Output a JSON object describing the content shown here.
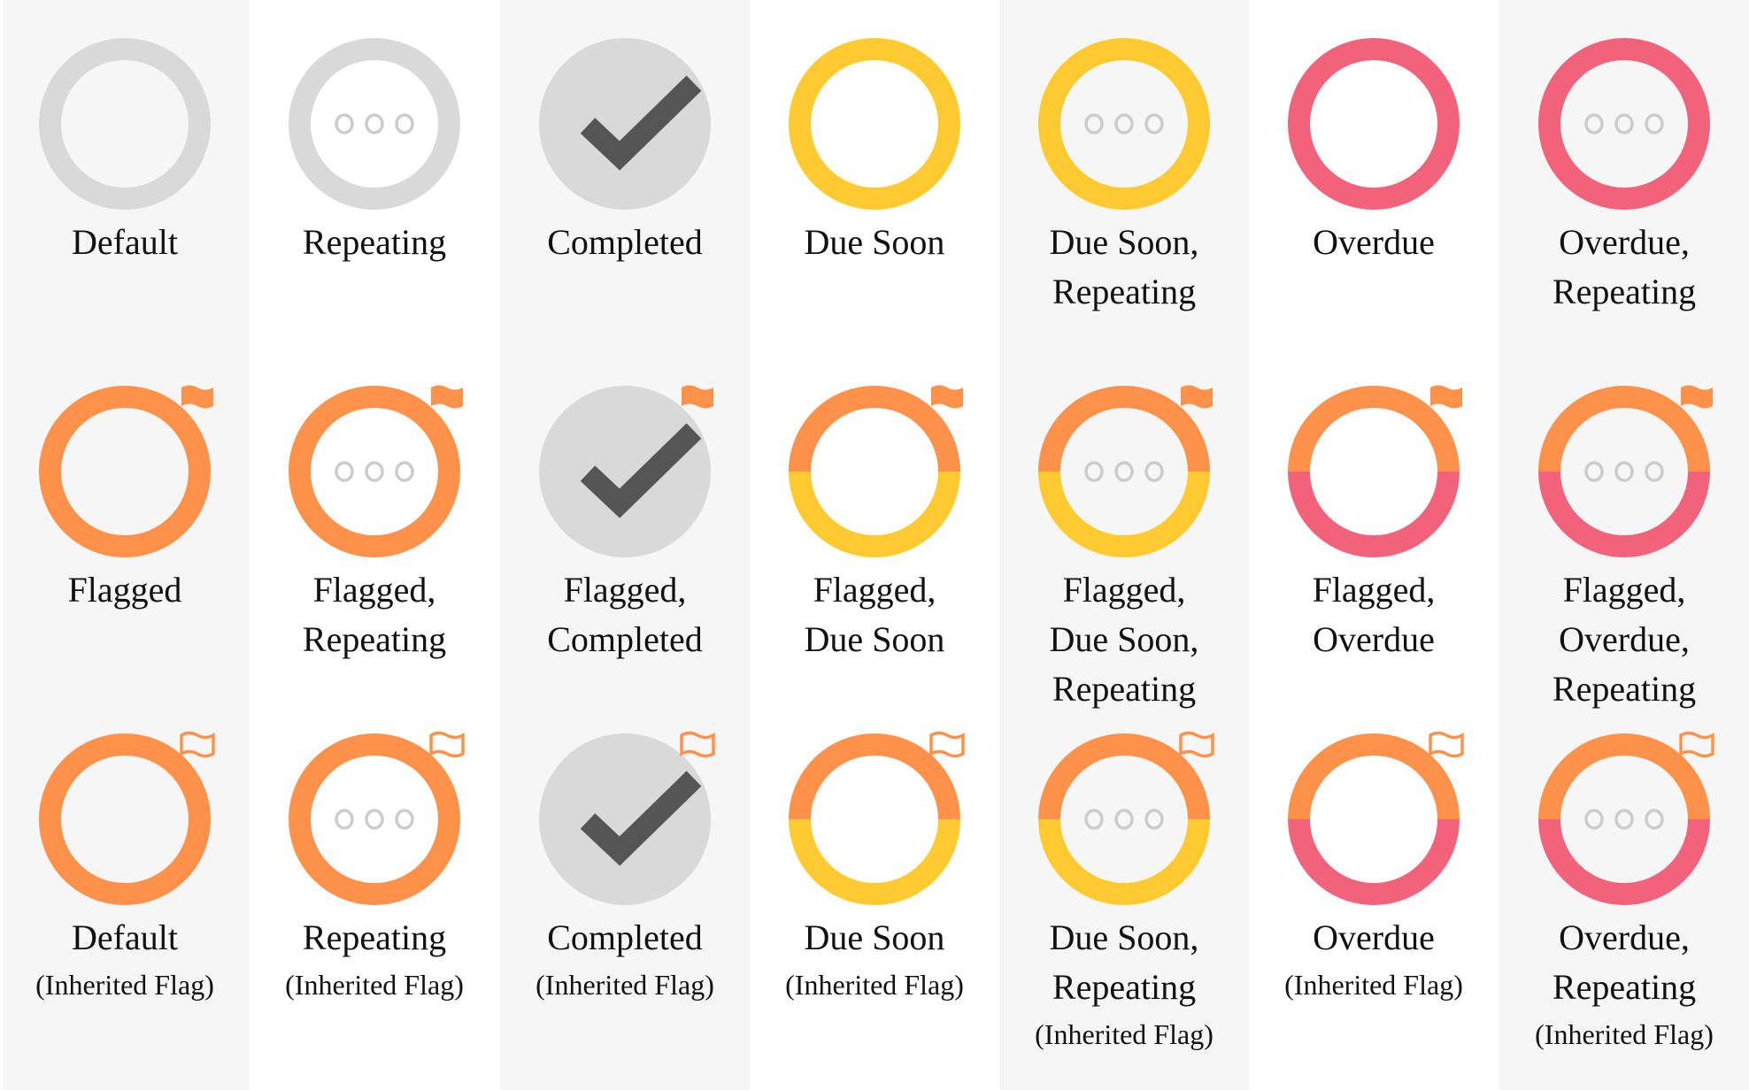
{
  "colors": {
    "gray": "#d9d9d9",
    "yellow": "#ffca30",
    "red": "#f2637b",
    "orange": "#ff914a",
    "check": "#555555",
    "dots": "#cccccc",
    "shade": "#f6f6f6"
  },
  "rows": [
    [
      {
        "lines": [
          "Default"
        ],
        "ring": "gray",
        "repeating": false,
        "completed": false,
        "flag": "none"
      },
      {
        "lines": [
          "Repeating"
        ],
        "ring": "gray",
        "repeating": true,
        "completed": false,
        "flag": "none"
      },
      {
        "lines": [
          "Completed"
        ],
        "ring": "gray",
        "repeating": false,
        "completed": true,
        "flag": "none"
      },
      {
        "lines": [
          "Due Soon"
        ],
        "ring": "yellow",
        "repeating": false,
        "completed": false,
        "flag": "none"
      },
      {
        "lines": [
          "Due Soon,",
          "Repeating"
        ],
        "ring": "yellow",
        "repeating": true,
        "completed": false,
        "flag": "none"
      },
      {
        "lines": [
          "Overdue"
        ],
        "ring": "red",
        "repeating": false,
        "completed": false,
        "flag": "none"
      },
      {
        "lines": [
          "Overdue,",
          "Repeating"
        ],
        "ring": "red",
        "repeating": true,
        "completed": false,
        "flag": "none"
      }
    ],
    [
      {
        "lines": [
          "Flagged"
        ],
        "ring": "orange",
        "repeating": false,
        "completed": false,
        "flag": "solid"
      },
      {
        "lines": [
          "Flagged,",
          "Repeating"
        ],
        "ring": "orange",
        "repeating": true,
        "completed": false,
        "flag": "solid"
      },
      {
        "lines": [
          "Flagged,",
          "Completed"
        ],
        "ring": "gray",
        "repeating": false,
        "completed": true,
        "flag": "solid"
      },
      {
        "lines": [
          "Flagged,",
          "Due Soon"
        ],
        "ring": "orange-yellow",
        "repeating": false,
        "completed": false,
        "flag": "solid"
      },
      {
        "lines": [
          "Flagged,",
          "Due Soon,",
          "Repeating"
        ],
        "ring": "orange-yellow",
        "repeating": true,
        "completed": false,
        "flag": "solid"
      },
      {
        "lines": [
          "Flagged,",
          "Overdue"
        ],
        "ring": "orange-red",
        "repeating": false,
        "completed": false,
        "flag": "solid"
      },
      {
        "lines": [
          "Flagged,",
          "Overdue,",
          "Repeating"
        ],
        "ring": "orange-red",
        "repeating": true,
        "completed": false,
        "flag": "solid"
      }
    ],
    [
      {
        "lines": [
          "Default"
        ],
        "sub": "(Inherited Flag)",
        "ring": "orange",
        "repeating": false,
        "completed": false,
        "flag": "outline"
      },
      {
        "lines": [
          "Repeating"
        ],
        "sub": "(Inherited Flag)",
        "ring": "orange",
        "repeating": true,
        "completed": false,
        "flag": "outline"
      },
      {
        "lines": [
          "Completed"
        ],
        "sub": "(Inherited Flag)",
        "ring": "gray",
        "repeating": false,
        "completed": true,
        "flag": "outline"
      },
      {
        "lines": [
          "Due Soon"
        ],
        "sub": "(Inherited Flag)",
        "ring": "orange-yellow",
        "repeating": false,
        "completed": false,
        "flag": "outline"
      },
      {
        "lines": [
          "Due Soon,",
          "Repeating"
        ],
        "sub": "(Inherited Flag)",
        "ring": "orange-yellow",
        "repeating": true,
        "completed": false,
        "flag": "outline"
      },
      {
        "lines": [
          "Overdue"
        ],
        "sub": "(Inherited Flag)",
        "ring": "orange-red",
        "repeating": false,
        "completed": false,
        "flag": "outline"
      },
      {
        "lines": [
          "Overdue,",
          "Repeating"
        ],
        "sub": "(Inherited Flag)",
        "ring": "orange-red",
        "repeating": true,
        "completed": false,
        "flag": "outline"
      }
    ]
  ]
}
